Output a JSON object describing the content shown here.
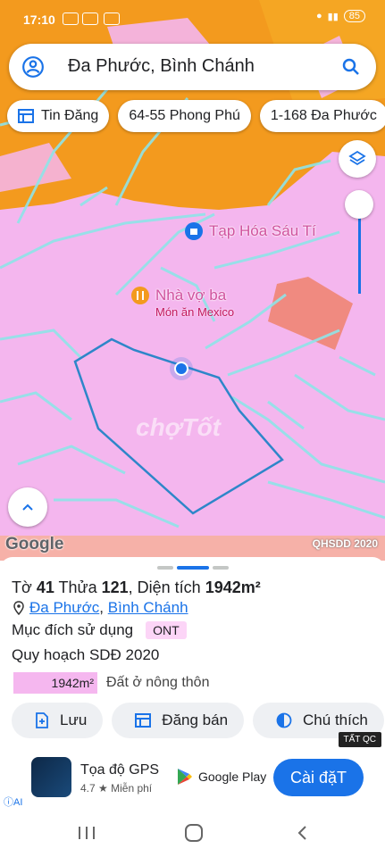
{
  "status_bar": {
    "time": "17:10",
    "battery": "85"
  },
  "search": {
    "query": "Đa Phước, Bình Chánh"
  },
  "chips": [
    {
      "label": "Tin Đăng",
      "icon": "listing-icon"
    },
    {
      "label": "64-55 Phong Phú"
    },
    {
      "label": "1-168 Đa Phước"
    }
  ],
  "map": {
    "poi_1": "Tạp Hóa Sáu Tí",
    "poi_2": "Nhà vợ ba",
    "poi_2_sub": "Món ăn Mexico",
    "watermark": "chợTốt",
    "google_logo": "Google",
    "layer_label": "QHSDD 2020",
    "colors": {
      "residential": "#f4b6ee",
      "orange": "#f39a1e",
      "red_parcel": "#f08a80",
      "road_line": "#8fe4e8",
      "boundary": "#2e86c9"
    }
  },
  "sheet": {
    "title_prefix": "Tờ ",
    "sheet_no": "41",
    "parcel_prefix": " Thửa ",
    "parcel_no": "121",
    "area_prefix": ", Diện tích ",
    "area": "1942m²",
    "loc_1": "Đa Phước",
    "loc_sep": ", ",
    "loc_2": "Bình Chánh",
    "purpose_label": "Mục đích sử dụng",
    "purpose_code": "ONT",
    "plan_label": "Quy hoạch SDĐ 2020",
    "legend_area": "1942m²",
    "legend_desc": "Đất ở nông thôn"
  },
  "actions": [
    {
      "label": "Lưu"
    },
    {
      "label": "Đăng bán"
    },
    {
      "label": "Chú thích"
    }
  ],
  "ad": {
    "tag": "TẤT QC",
    "app_name": "Tọa độ GPS",
    "rating": "4.7 ★  Miễn phí",
    "store": "Google Play",
    "install": "Cài đặT",
    "ai": "AI"
  }
}
